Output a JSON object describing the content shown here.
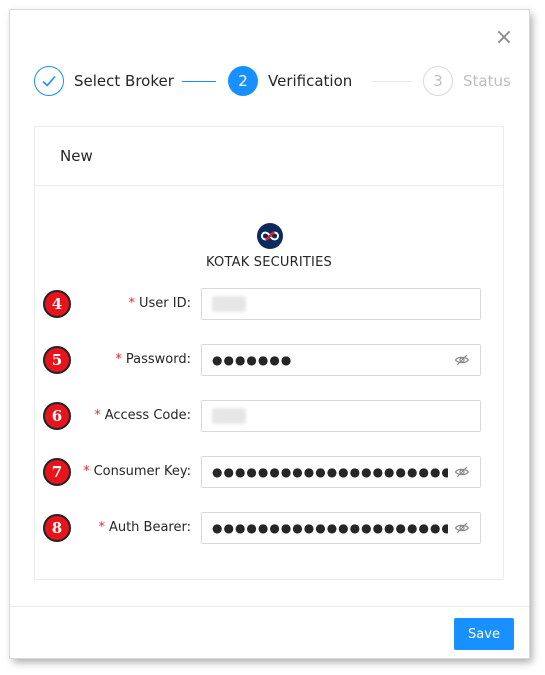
{
  "dialog": {
    "close_glyph": "×"
  },
  "steps": [
    {
      "label": "Select Broker",
      "state": "done",
      "icon": "check-icon"
    },
    {
      "number": "2",
      "label": "Verification",
      "state": "active"
    },
    {
      "number": "3",
      "label": "Status",
      "state": "pending"
    }
  ],
  "card": {
    "title": "New",
    "broker_name": "KOTAK SECURITIES",
    "broker_logo": "kotak-logo"
  },
  "fields": [
    {
      "badge": "4",
      "required": "*",
      "label": "User ID:",
      "value": "",
      "type": "text",
      "masked": false
    },
    {
      "badge": "5",
      "required": "*",
      "label": "Password:",
      "value": "●●●●●●●",
      "type": "password",
      "masked": true
    },
    {
      "badge": "6",
      "required": "*",
      "label": "Access Code:",
      "value": "",
      "type": "text",
      "masked": false
    },
    {
      "badge": "7",
      "required": "*",
      "label": "Consumer Key:",
      "value": "●●●●●●●●●●●●●●●●●●●●●●●●●●●●●",
      "type": "password",
      "masked": true
    },
    {
      "badge": "8",
      "required": "*",
      "label": "Auth Bearer:",
      "value": "●●●●●●●●●●●●●●●●●●●●●●●●●●●●●●●●",
      "type": "password",
      "masked": true
    }
  ],
  "footer": {
    "save_label": "Save"
  },
  "colors": {
    "primary": "#1890ff",
    "badge": "#e8141c",
    "required": "#f5222d"
  }
}
